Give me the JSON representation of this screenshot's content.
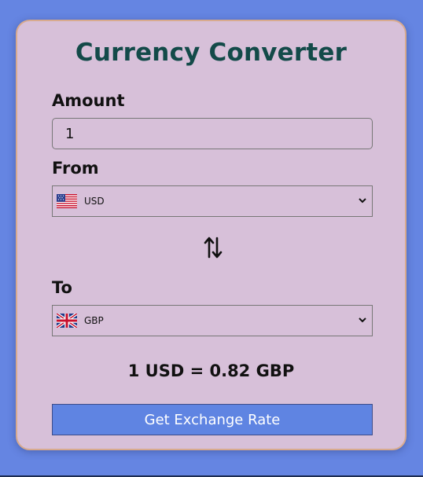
{
  "app": {
    "title": "Currency Converter"
  },
  "amount": {
    "label": "Amount",
    "value": "1"
  },
  "from": {
    "label": "From",
    "currency": "USD",
    "flag_icon": "us-flag-icon"
  },
  "swap": {
    "icon": "swap-arrows-icon"
  },
  "to": {
    "label": "To",
    "currency": "GBP",
    "flag_icon": "uk-flag-icon"
  },
  "result": {
    "text": "1 USD = 0.82 GBP"
  },
  "button": {
    "label": "Get Exchange Rate"
  },
  "colors": {
    "background": "#6585e2",
    "card": "#d7c0d9",
    "card_border": "#d8aa8e",
    "title": "#134a49",
    "button": "#5f84e2"
  }
}
